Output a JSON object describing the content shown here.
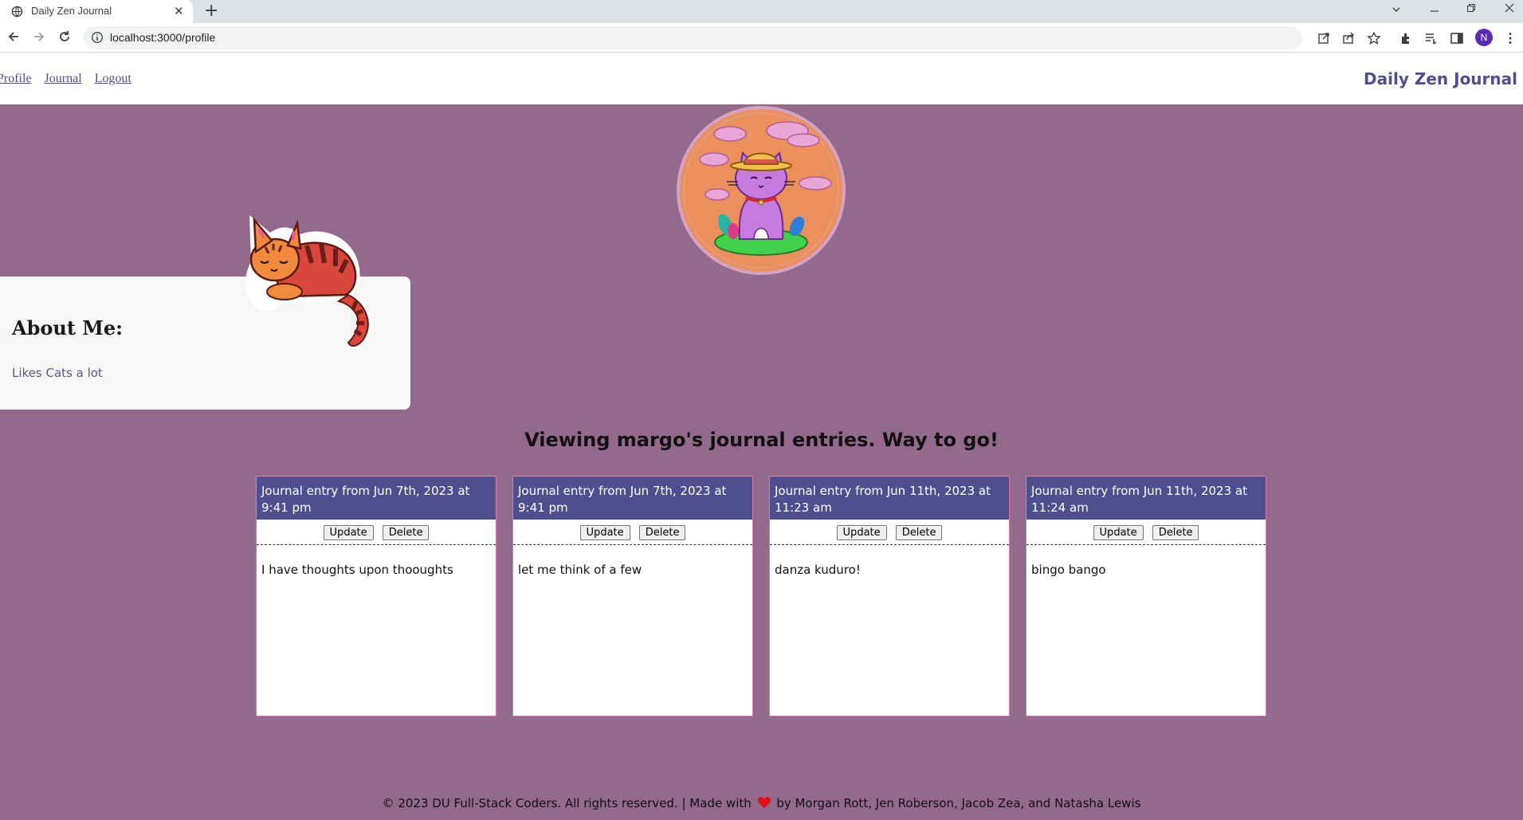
{
  "browser": {
    "tab_title": "Daily Zen Journal",
    "tab_close": "✕",
    "new_tab": "+",
    "url": "localhost:3000/profile",
    "profile_initial": "N"
  },
  "header": {
    "nav": [
      "Profile",
      "Journal",
      "Logout"
    ],
    "brand": "Daily Zen Journal"
  },
  "about": {
    "title": "About Me:",
    "text": "Likes Cats a lot"
  },
  "entries_heading": "Viewing margo's journal entries. Way to go!",
  "entries": [
    {
      "header": "Journal entry from Jun 7th, 2023 at 9:41 pm",
      "update": "Update",
      "delete": "Delete",
      "body": "I have thoughts upon thooughts"
    },
    {
      "header": "Journal entry from Jun 7th, 2023 at 9:41 pm",
      "update": "Update",
      "delete": "Delete",
      "body": "let me think of a few"
    },
    {
      "header": "Journal entry from Jun 11th, 2023 at 11:23 am",
      "update": "Update",
      "delete": "Delete",
      "body": "danza kuduro!"
    },
    {
      "header": "Journal entry from Jun 11th, 2023 at 11:24 am",
      "update": "Update",
      "delete": "Delete",
      "body": "bingo bango"
    }
  ],
  "footer": {
    "before": "© 2023 DU Full-Stack Coders. All rights reserved. | Made with",
    "after": "by Morgan Rott, Jen Roberson, Jacob Zea, and Natasha Lewis"
  },
  "colors": {
    "page_bg": "#936a8c",
    "accent": "#4f4f8f",
    "heart": "#e0141e"
  }
}
